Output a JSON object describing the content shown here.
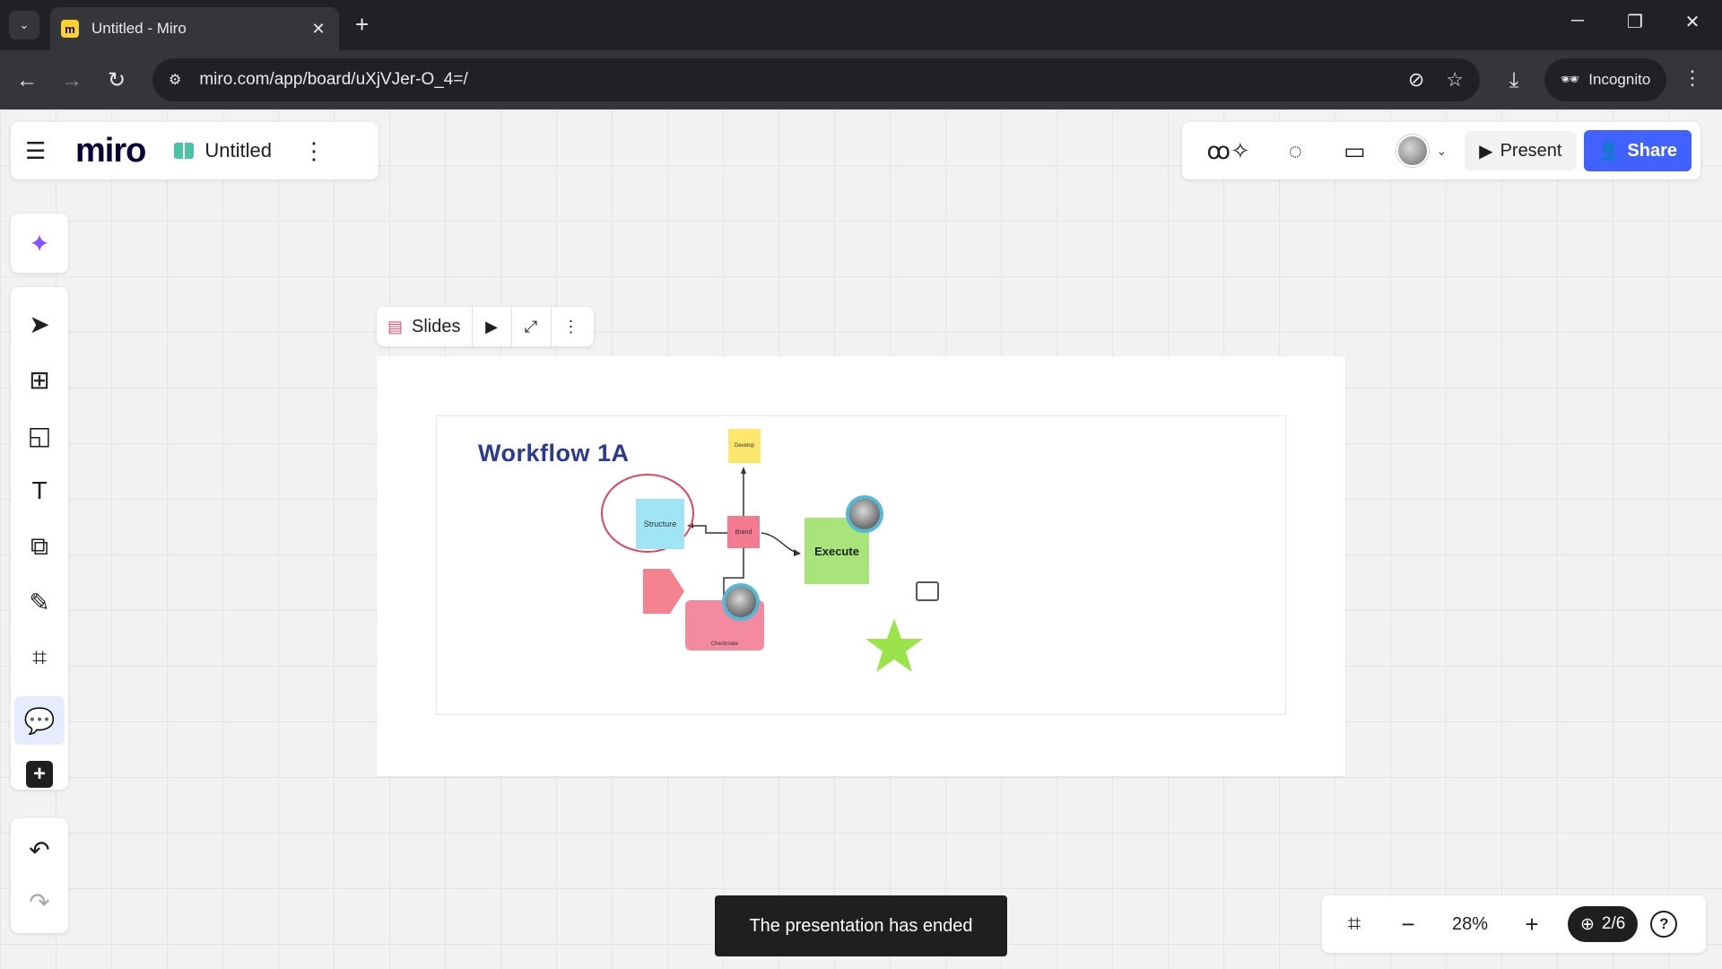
{
  "browser": {
    "tab_title": "Untitled - Miro",
    "url": "miro.com/app/board/uXjVJer-O_4=/",
    "incognito_label": "Incognito"
  },
  "header": {
    "logo": "miro",
    "board_name": "Untitled"
  },
  "collab": {
    "present_label": "Present",
    "share_label": "Share"
  },
  "slides": {
    "label": "Slides"
  },
  "board": {
    "title": "Workflow 1A",
    "nodes": {
      "yellow": "Develop",
      "structure": "Structure",
      "red": "Brand",
      "execute": "Execute",
      "pink": "Checkmate"
    }
  },
  "toast": "The presentation has ended",
  "zoom": {
    "value": "28%",
    "frames_counter": "2/6"
  }
}
